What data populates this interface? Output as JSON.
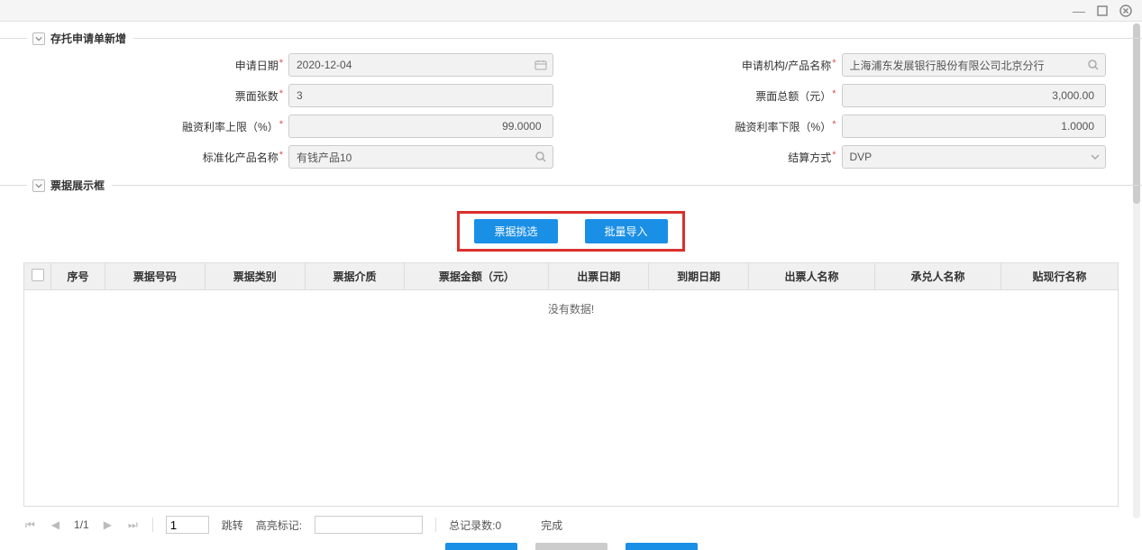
{
  "window": {
    "minimize_icon": "minimize-icon",
    "maximize_icon": "maximize-icon",
    "close_icon": "close-icon"
  },
  "section1": {
    "title": "存托申请单新增"
  },
  "form": {
    "apply_date": {
      "label": "申请日期",
      "value": "2020-12-04"
    },
    "apply_org": {
      "label": "申请机构/产品名称",
      "value": "上海浦东发展银行股份有限公司北京分行"
    },
    "face_count": {
      "label": "票面张数",
      "value": "3"
    },
    "face_total": {
      "label": "票面总额（元）",
      "value": "3,000.00"
    },
    "rate_upper": {
      "label": "融资利率上限（%）",
      "value": "99.0000"
    },
    "rate_lower": {
      "label": "融资利率下限（%）",
      "value": "1.0000"
    },
    "std_product": {
      "label": "标准化产品名称",
      "value": "有钱产品10"
    },
    "settle_mode": {
      "label": "结算方式",
      "value": "DVP"
    }
  },
  "section2": {
    "title": "票据展示框"
  },
  "buttons": {
    "pick": "票据挑选",
    "import": "批量导入"
  },
  "table": {
    "headers": [
      "序号",
      "票据号码",
      "票据类别",
      "票据介质",
      "票据金额（元）",
      "出票日期",
      "到期日期",
      "出票人名称",
      "承兑人名称",
      "贴现行名称"
    ],
    "nodata": "没有数据!"
  },
  "pager": {
    "page_info": "1/1",
    "page_input": "1",
    "jump": "跳转",
    "highlight_label": "高亮标记:",
    "total_label": "总记录数:0",
    "status": "完成"
  }
}
